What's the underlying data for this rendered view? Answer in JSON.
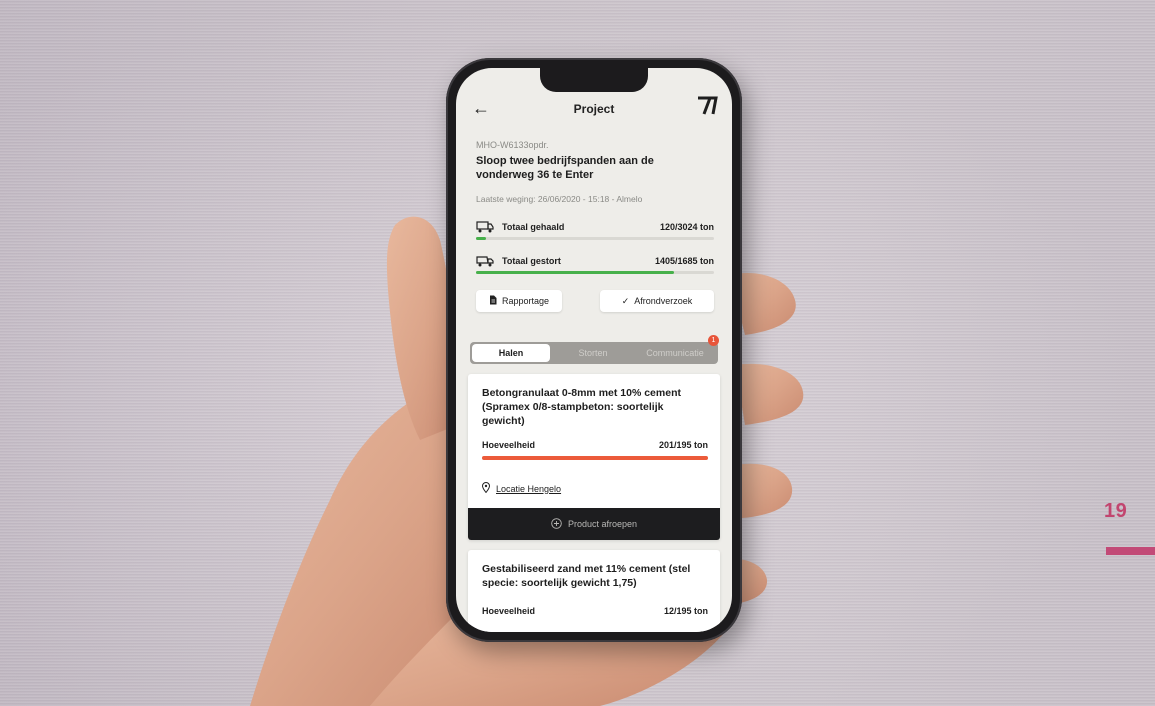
{
  "page_number": "19",
  "header": {
    "title": "Project"
  },
  "project": {
    "code": "MHO-W6133opdr.",
    "title": "Sloop twee bedrijfspanden aan de vonderweg 36 te Enter",
    "last_weighing": "Laatste weging: 26/06/2020 - 15:18 - Almelo"
  },
  "stats": [
    {
      "label": "Totaal gehaald",
      "value": "120/3024 ton",
      "progress": 0.04
    },
    {
      "label": "Totaal gestort",
      "value": "1405/1685 ton",
      "progress": 0.83
    }
  ],
  "buttons": {
    "report": "Rapportage",
    "complete": "Afrondverzoek"
  },
  "tabs": [
    {
      "label": "Halen",
      "active": true
    },
    {
      "label": "Storten",
      "active": false
    },
    {
      "label": "Communicatie",
      "active": false,
      "badge": "1"
    }
  ],
  "products": [
    {
      "title": "Betongranulaat 0-8mm met 10% cement (Spramex 0/8-stampbeton: soortelijk gewicht)",
      "qty_label": "Hoeveelheid",
      "qty_value": "201/195 ton",
      "progress": 1.0,
      "location": "Locatie Hengelo",
      "action": "Product afroepen"
    },
    {
      "title": "Gestabiliseerd zand met 11% cement (stel specie: soortelijk gewicht 1,75)",
      "qty_label": "Hoeveelheid",
      "qty_value": "12/195 ton"
    }
  ],
  "colors": {
    "accent_green": "#47b04b",
    "accent_orange": "#ec5b3a",
    "page_accent": "#c2456f"
  }
}
